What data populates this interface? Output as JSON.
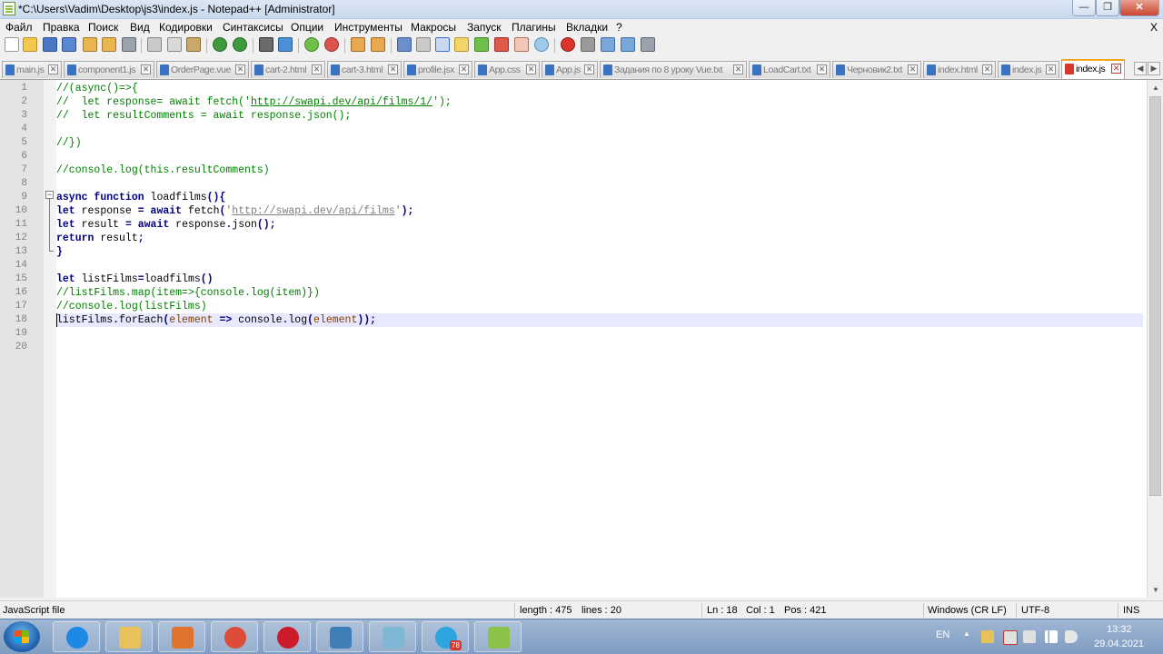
{
  "window": {
    "title": "*C:\\Users\\Vadim\\Desktop\\js3\\index.js - Notepad++ [Administrator]",
    "min_glyph": "—",
    "max_glyph": "❐",
    "close_glyph": "✕"
  },
  "menu": {
    "items": [
      "Файл",
      "Правка",
      "Поиск",
      "Вид",
      "Кодировки",
      "Синтаксисы",
      "Опции",
      "Инструменты",
      "Макросы",
      "Запуск",
      "Плагины",
      "Вкладки",
      "?"
    ],
    "close_glyph": "X"
  },
  "tabs": [
    {
      "label": "main.js",
      "active": false
    },
    {
      "label": "component1.js",
      "active": false
    },
    {
      "label": "OrderPage.vue",
      "active": false
    },
    {
      "label": "cart-2.html",
      "active": false
    },
    {
      "label": "cart-3.html",
      "active": false
    },
    {
      "label": "profile.jsx",
      "active": false
    },
    {
      "label": "App.css",
      "active": false
    },
    {
      "label": "App.js",
      "active": false
    },
    {
      "label": "Задания по 8 уроку Vue.txt",
      "active": false
    },
    {
      "label": "LoadCart.txt",
      "active": false
    },
    {
      "label": "Черновик2.txt",
      "active": false
    },
    {
      "label": "index.html",
      "active": false
    },
    {
      "label": "index.js",
      "active": false
    },
    {
      "label": "index.js",
      "active": true
    }
  ],
  "tab_close_glyph": "✕",
  "tab_nav": {
    "left": "◀",
    "right": "▶"
  },
  "editor": {
    "line_numbers": [
      "1",
      "2",
      "3",
      "4",
      "5",
      "6",
      "7",
      "8",
      "9",
      "10",
      "11",
      "12",
      "13",
      "14",
      "15",
      "16",
      "17",
      "18",
      "19",
      "20"
    ],
    "current_line": 18,
    "fold_glyph": "−",
    "lines": [
      [
        {
          "t": "//(async()=>{",
          "c": "c-com"
        }
      ],
      [
        {
          "t": "//  let response= await fetch('",
          "c": "c-com"
        },
        {
          "t": "http://swapi.dev/api/films/1/",
          "c": "c-url-g"
        },
        {
          "t": "');",
          "c": "c-com"
        }
      ],
      [
        {
          "t": "//  let resultComments = await response.json();",
          "c": "c-com"
        }
      ],
      [],
      [
        {
          "t": "//})",
          "c": "c-com"
        }
      ],
      [],
      [
        {
          "t": "//console.log(this.resultComments)",
          "c": "c-com"
        }
      ],
      [],
      [
        {
          "t": "async",
          "c": "c-kw"
        },
        {
          "t": " ",
          "c": "c-txt"
        },
        {
          "t": "function",
          "c": "c-kw"
        },
        {
          "t": " loadfilms",
          "c": "c-txt"
        },
        {
          "t": "(){",
          "c": "c-op"
        }
      ],
      [
        {
          "t": "let",
          "c": "c-kw"
        },
        {
          "t": " response ",
          "c": "c-txt"
        },
        {
          "t": "=",
          "c": "c-op"
        },
        {
          "t": " ",
          "c": "c-txt"
        },
        {
          "t": "await",
          "c": "c-kw"
        },
        {
          "t": " fetch",
          "c": "c-txt"
        },
        {
          "t": "(",
          "c": "c-op"
        },
        {
          "t": "'",
          "c": "c-str"
        },
        {
          "t": "http://swapi.dev/api/films",
          "c": "c-url"
        },
        {
          "t": "'",
          "c": "c-str"
        },
        {
          "t": ");",
          "c": "c-op"
        }
      ],
      [
        {
          "t": "let",
          "c": "c-kw"
        },
        {
          "t": " result ",
          "c": "c-txt"
        },
        {
          "t": "=",
          "c": "c-op"
        },
        {
          "t": " ",
          "c": "c-txt"
        },
        {
          "t": "await",
          "c": "c-kw"
        },
        {
          "t": " response",
          "c": "c-txt"
        },
        {
          "t": ".",
          "c": "c-op"
        },
        {
          "t": "json",
          "c": "c-txt"
        },
        {
          "t": "();",
          "c": "c-op"
        }
      ],
      [
        {
          "t": "return",
          "c": "c-kw"
        },
        {
          "t": " result",
          "c": "c-txt"
        },
        {
          "t": ";",
          "c": "c-op"
        }
      ],
      [
        {
          "t": "}",
          "c": "c-op"
        }
      ],
      [],
      [
        {
          "t": "let",
          "c": "c-kw"
        },
        {
          "t": " listFilms",
          "c": "c-txt"
        },
        {
          "t": "=",
          "c": "c-op"
        },
        {
          "t": "loadfilms",
          "c": "c-txt"
        },
        {
          "t": "()",
          "c": "c-op"
        }
      ],
      [
        {
          "t": "//listFilms.map(item=>{console.log(item)})",
          "c": "c-com"
        }
      ],
      [
        {
          "t": "//console.log(listFilms)",
          "c": "c-com"
        }
      ],
      [
        {
          "t": "listFilms",
          "c": "c-txt"
        },
        {
          "t": ".",
          "c": "c-op"
        },
        {
          "t": "forEach",
          "c": "c-txt"
        },
        {
          "t": "(",
          "c": "c-op"
        },
        {
          "t": "element",
          "c": "c-brown"
        },
        {
          "t": " ",
          "c": "c-txt"
        },
        {
          "t": "=>",
          "c": "c-op"
        },
        {
          "t": " console",
          "c": "c-txt"
        },
        {
          "t": ".",
          "c": "c-op"
        },
        {
          "t": "log",
          "c": "c-txt"
        },
        {
          "t": "(",
          "c": "c-op"
        },
        {
          "t": "element",
          "c": "c-brown"
        },
        {
          "t": "));",
          "c": "c-op"
        }
      ],
      [],
      []
    ]
  },
  "scrollbar": {
    "up": "▲",
    "down": "▼"
  },
  "statusbar": {
    "file_type": "JavaScript file",
    "length": "length : 475",
    "lines": "lines : 20",
    "ln": "Ln : 18",
    "col": "Col : 1",
    "pos": "Pos : 421",
    "eol": "Windows (CR LF)",
    "encoding": "UTF-8",
    "mode": "INS"
  },
  "taskbar": {
    "apps": [
      {
        "name": "internet-explorer",
        "color": "#1e88e5"
      },
      {
        "name": "file-explorer",
        "color": "#e8c15a"
      },
      {
        "name": "media-player",
        "color": "#e0732b"
      },
      {
        "name": "chrome",
        "color": "#dd4b39"
      },
      {
        "name": "opera",
        "color": "#cc1b2b"
      },
      {
        "name": "image-viewer",
        "color": "#3f7fb8"
      },
      {
        "name": "generic-app",
        "color": "#7fb8d6"
      },
      {
        "name": "telegram",
        "color": "#2ca5e0"
      },
      {
        "name": "notepad-plus-plus",
        "color": "#8bc34a"
      }
    ],
    "telegram_badge": "78",
    "lang": "EN",
    "time": "13:32",
    "date": "29.04.2021"
  }
}
